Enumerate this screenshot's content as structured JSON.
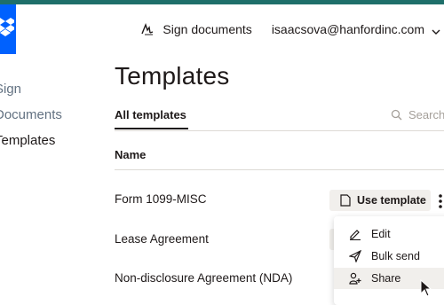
{
  "header": {
    "sign_documents_label": "Sign documents",
    "account_email": "isaacsova@hanfordinc.com"
  },
  "sidebar": {
    "items": [
      {
        "label": "Sign",
        "active": false
      },
      {
        "label": "Documents",
        "active": false
      },
      {
        "label": "Templates",
        "active": true
      }
    ]
  },
  "page": {
    "title": "Templates"
  },
  "tabs": {
    "all_label": "All templates"
  },
  "search": {
    "placeholder": "Search"
  },
  "table": {
    "column_name": "Name",
    "rows": [
      {
        "name": "Form 1099-MISC"
      },
      {
        "name": "Lease Agreement"
      },
      {
        "name": "Non-disclosure Agreement (NDA)"
      }
    ],
    "use_template_label": "Use template"
  },
  "menu": {
    "items": [
      {
        "label": "Edit",
        "icon": "pencil-icon"
      },
      {
        "label": "Bulk send",
        "icon": "send-icon"
      },
      {
        "label": "Share",
        "icon": "add-person-icon",
        "hovered": true
      }
    ]
  },
  "colors": {
    "brand_blue": "#0061fe",
    "top_stripe": "#1e6f6a",
    "hover_bg": "#f1efec"
  }
}
